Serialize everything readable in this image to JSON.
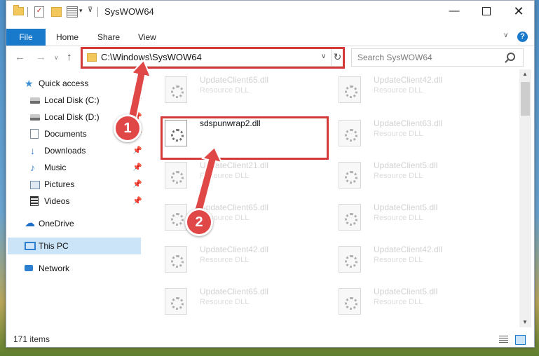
{
  "window": {
    "title": "SysWOW64",
    "controls": {
      "minimize": "—",
      "maximize": "",
      "close": "✕"
    }
  },
  "ribbon": {
    "file": "File",
    "tabs": [
      "Home",
      "Share",
      "View"
    ],
    "help": "?"
  },
  "address": {
    "path": "C:\\Windows\\SysWOW64",
    "search_placeholder": "Search SysWOW64"
  },
  "nav": {
    "items": [
      {
        "label": "Quick access",
        "icon": "star-icon",
        "pinned": false
      },
      {
        "label": "Local Disk (C:)",
        "icon": "drive-icon",
        "pinned": true
      },
      {
        "label": "Local Disk (D:)",
        "icon": "drive-icon",
        "pinned": true
      },
      {
        "label": "Documents",
        "icon": "documents-icon",
        "pinned": true
      },
      {
        "label": "Downloads",
        "icon": "downloads-icon",
        "pinned": true
      },
      {
        "label": "Music",
        "icon": "music-icon",
        "pinned": true
      },
      {
        "label": "Pictures",
        "icon": "pictures-icon",
        "pinned": true
      },
      {
        "label": "Videos",
        "icon": "videos-icon",
        "pinned": true
      },
      {
        "label": "OneDrive",
        "icon": "onedrive-icon",
        "pinned": false
      },
      {
        "label": "This PC",
        "icon": "this-pc-icon",
        "pinned": false,
        "selected": true
      },
      {
        "label": "Network",
        "icon": "network-icon",
        "pinned": false
      }
    ]
  },
  "files": [
    {
      "name": "UpdateClient65.dll",
      "type": "Resource DLL"
    },
    {
      "name": "UpdateClient42.dll",
      "type": "Resource DLL"
    },
    {
      "name": "sdspunwrap2.dll",
      "type": ""
    },
    {
      "name": "UpdateClient63.dll",
      "type": "Resource DLL"
    },
    {
      "name": "UpdateClient21.dll",
      "type": "Resource DLL"
    },
    {
      "name": "UpdateClient5.dll",
      "type": "Resource DLL"
    },
    {
      "name": "UpdateClient65.dll",
      "type": "Resource DLL"
    },
    {
      "name": "UpdateClient5.dll",
      "type": "Resource DLL"
    },
    {
      "name": "UpdateClient42.dll",
      "type": "Resource DLL"
    },
    {
      "name": "UpdateClient42.dll",
      "type": "Resource DLL"
    },
    {
      "name": "UpdateClient65.dll",
      "type": "Resource DLL"
    },
    {
      "name": "UpdateClient5.dll",
      "type": "Resource DLL"
    }
  ],
  "status": {
    "count": "171 items"
  },
  "annotations": {
    "step1": "1",
    "step2": "2"
  },
  "colors": {
    "accent": "#1979ca",
    "highlight": "#d43a3a",
    "selected": "#cce4f7"
  }
}
